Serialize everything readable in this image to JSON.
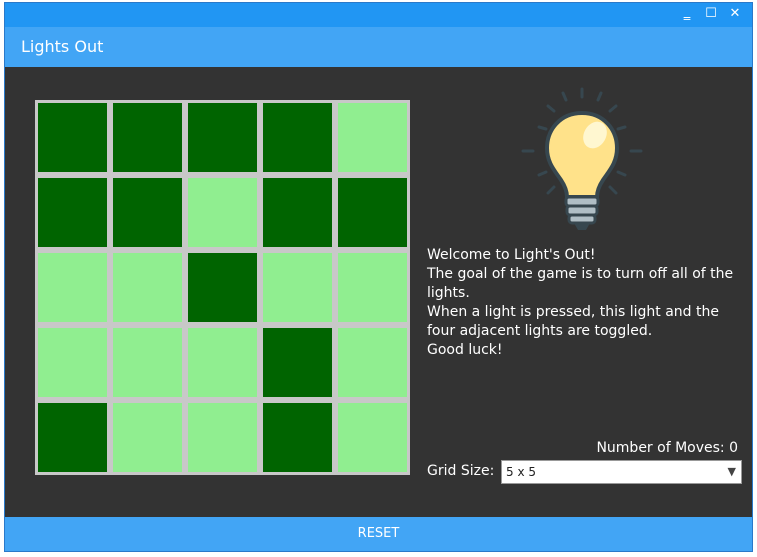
{
  "window": {
    "title": "Lights Out",
    "controls": {
      "minimize": "‗",
      "maximize": "☐",
      "close": "✕"
    }
  },
  "grid": {
    "size": 5,
    "states": [
      [
        0,
        0,
        0,
        0,
        1
      ],
      [
        0,
        0,
        1,
        0,
        0
      ],
      [
        1,
        1,
        0,
        1,
        1
      ],
      [
        1,
        1,
        1,
        0,
        1
      ],
      [
        0,
        1,
        1,
        0,
        1
      ]
    ],
    "colors": {
      "on": "#90ee90",
      "off": "#006400",
      "border": "#c8c8c8"
    }
  },
  "bulb_icon": "lightbulb-icon",
  "message": {
    "line1": "Welcome to Light's Out!",
    "line2": "The goal of the game is to turn off all of the lights.",
    "line3": "When a light is pressed, this light and the four adjacent lights are toggled.",
    "line4": "Good luck!"
  },
  "moves": {
    "label": "Number of Moves: 0"
  },
  "grid_size": {
    "label": "Grid Size:",
    "selected": "5 x 5"
  },
  "reset_label": "RESET"
}
